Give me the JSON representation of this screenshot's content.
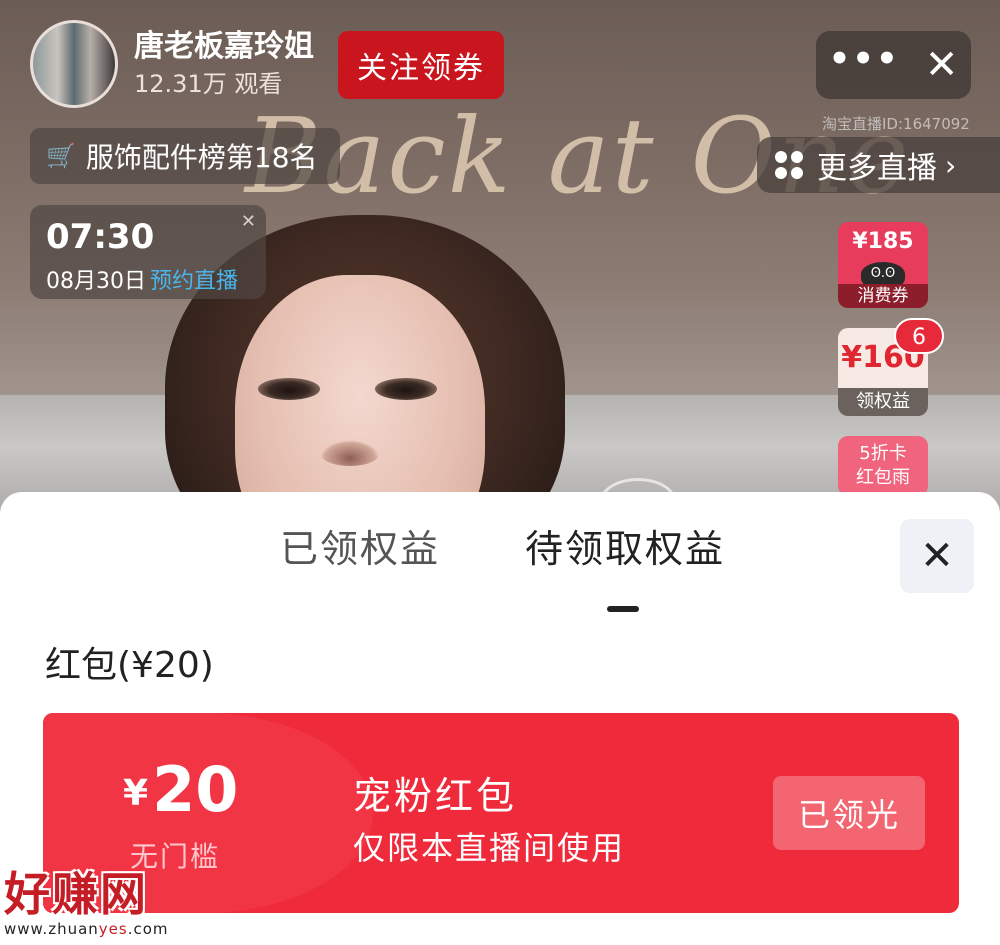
{
  "stream": {
    "host_name": "唐老板嘉玲姐",
    "viewers": "12.31万 观看",
    "follow_label": "关注领券",
    "more_label": "•••",
    "close_label": "✕",
    "stream_id": "淘宝直播ID:1647092",
    "overlay_text": "Back at One",
    "rank": {
      "icon": "cart-icon",
      "label": "服饰配件榜第18名"
    },
    "more_live": {
      "label": "更多直播",
      "chevron": "›"
    },
    "schedule": {
      "time": "07:30",
      "date": "08月30日",
      "reserve_label": "预约直播",
      "dismiss": "✕"
    }
  },
  "side_cards": {
    "consumer_coupon": {
      "amount": "¥185",
      "label": "消费券"
    },
    "benefits": {
      "amount": "¥160",
      "label": "领权益",
      "badge": "6"
    },
    "red_packet_rain": {
      "line1": "5折卡",
      "line2": "红包雨"
    }
  },
  "sheet": {
    "tabs": [
      {
        "label": "已领权益",
        "active": false
      },
      {
        "label": "待领取权益",
        "active": true
      }
    ],
    "close_label": "✕",
    "section_title": "红包(¥20)",
    "coupon": {
      "currency": "¥",
      "amount": "20",
      "threshold": "无门槛",
      "title": "宠粉红包",
      "description": "仅限本直播间使用",
      "button_label": "已领光"
    }
  },
  "watermark": {
    "brand": "好赚网",
    "url_prefix": "www.zhuan",
    "url_highlight": "yes",
    "url_suffix": ".com"
  },
  "colors": {
    "accent_red": "#ef2a3a",
    "follow_red": "#c9161e",
    "reserve_blue": "#48b6ee"
  }
}
